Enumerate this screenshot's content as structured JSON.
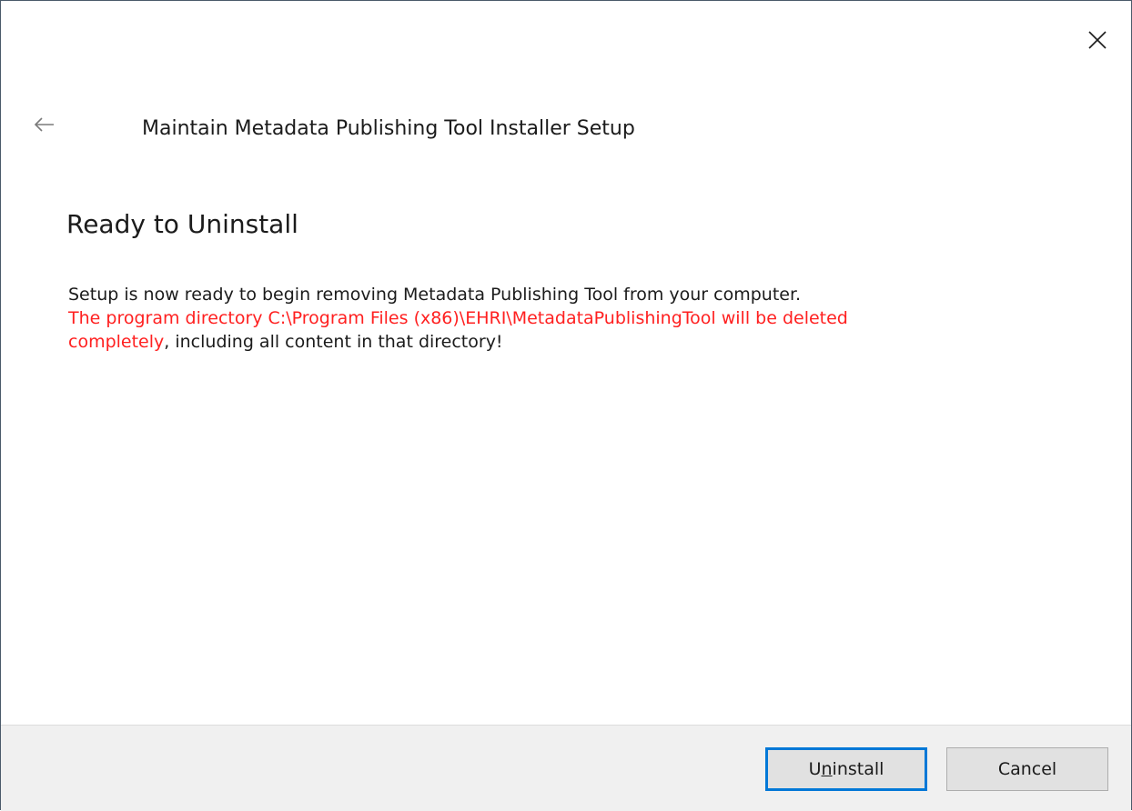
{
  "window": {
    "title": "Maintain Metadata Publishing Tool Installer Setup"
  },
  "icons": {
    "close": "close-icon",
    "back": "back-arrow-icon"
  },
  "page": {
    "heading": "Ready to Uninstall",
    "line1": "Setup is now ready to begin removing Metadata Publishing Tool from your computer.",
    "warning_part1": "The program directory C:\\Program Files (x86)\\EHRI\\MetadataPublishingTool will be deleted",
    "warning_part2": "completely",
    "trailing_text": ", including all content in that directory!"
  },
  "buttons": {
    "uninstall_prefix": "U",
    "uninstall_accel": "n",
    "uninstall_suffix": "install",
    "cancel_label": "Cancel"
  },
  "colors": {
    "warning": "#ff2020",
    "default_button_border": "#0078d7",
    "footer_background": "#f0f0f0"
  }
}
